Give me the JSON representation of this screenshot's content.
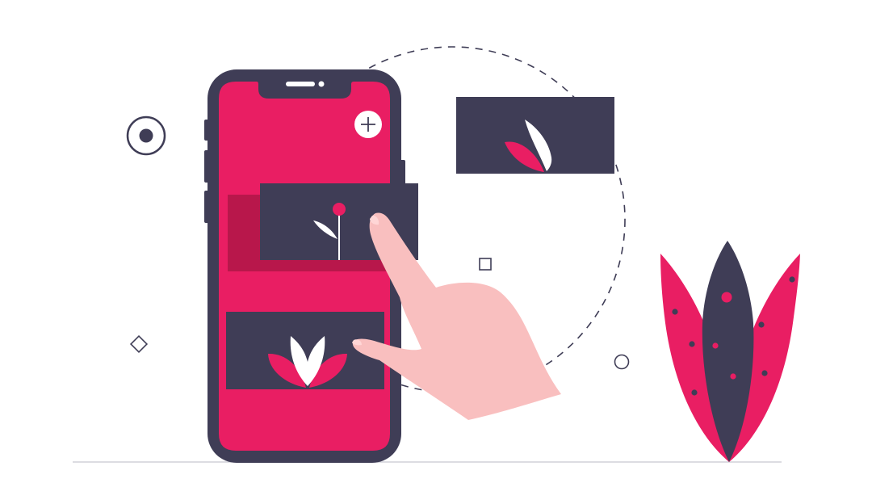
{
  "colors": {
    "background": "#ffffff",
    "accent": "#e91e63",
    "dark": "#3f3d56",
    "accent_dark": "#b8174b",
    "skin": "#f9bfbf",
    "outline": "#3f3d56",
    "ground": "#d0d0d8"
  },
  "icons": {
    "add_button": "plus-icon",
    "radio": "radio-icon",
    "diamond": "diamond-icon",
    "square": "square-icon",
    "circle": "circle-icon"
  }
}
